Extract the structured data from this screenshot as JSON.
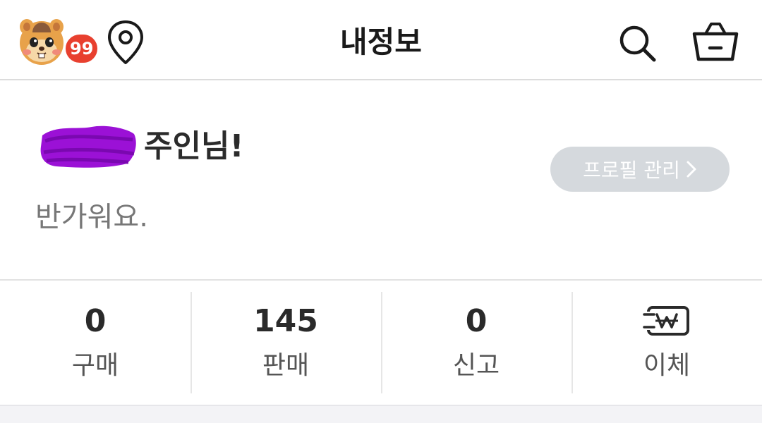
{
  "header": {
    "title": "내정보",
    "avatar_icon": "hamster-avatar-icon",
    "notification_count": "99",
    "badge_color": "#e8402f",
    "location_icon": "map-pin-icon",
    "search_icon": "search-icon",
    "cart_icon": "shopping-basket-icon"
  },
  "profile": {
    "name_suffix": "주인님!",
    "welcome": "반가워요.",
    "manage_button": "프로필 관리",
    "redaction_color": "#9b11d6"
  },
  "stats": [
    {
      "value": "0",
      "label": "구매"
    },
    {
      "value": "145",
      "label": "판매"
    },
    {
      "value": "0",
      "label": "신고"
    },
    {
      "value": "",
      "label": "이체",
      "icon": "won-transfer-icon"
    }
  ]
}
